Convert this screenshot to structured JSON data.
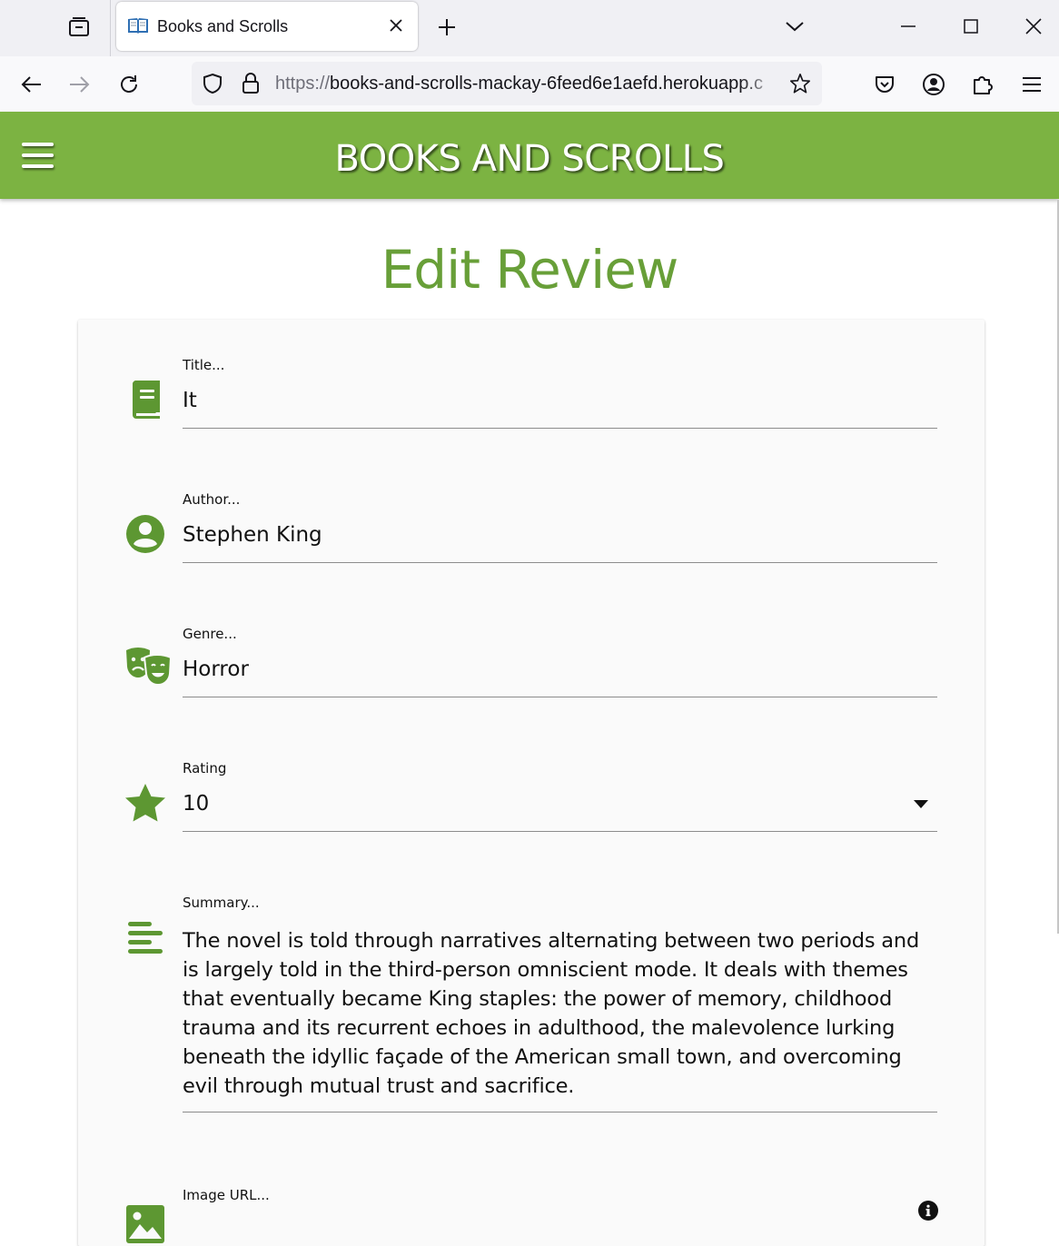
{
  "browser": {
    "tab": {
      "title": "Books and Scrolls"
    },
    "url": {
      "protocol": "https://",
      "host": "books-and-scrolls-mackay-6feed6e1aefd.herokuapp.c"
    }
  },
  "header": {
    "brand": "BOOKS AND SCROLLS"
  },
  "page": {
    "heading": "Edit Review"
  },
  "form": {
    "title": {
      "label": "Title...",
      "value": "It",
      "icon": "book-icon"
    },
    "author": {
      "label": "Author...",
      "value": "Stephen King",
      "icon": "account-circle-icon"
    },
    "genre": {
      "label": "Genre...",
      "value": "Horror",
      "icon": "theater-masks-icon"
    },
    "rating": {
      "label": "Rating",
      "value": "10",
      "icon": "star-icon"
    },
    "summary": {
      "label": "Summary...",
      "value": "The novel is told through narratives alternating between two periods and is largely told in the third-person omniscient mode. It deals with themes that eventually became King staples: the power of memory, childhood trauma and its recurrent echoes in adulthood, the malevolence lurking beneath the idyllic façade of the American small town, and overcoming evil through mutual trust and sacrifice.",
      "icon": "notes-icon"
    },
    "image_url": {
      "label": "Image URL...",
      "icon": "image-icon"
    }
  },
  "colors": {
    "brand_green": "#7cb342",
    "heading_green": "#689f38",
    "icon_green": "#5d9732"
  }
}
